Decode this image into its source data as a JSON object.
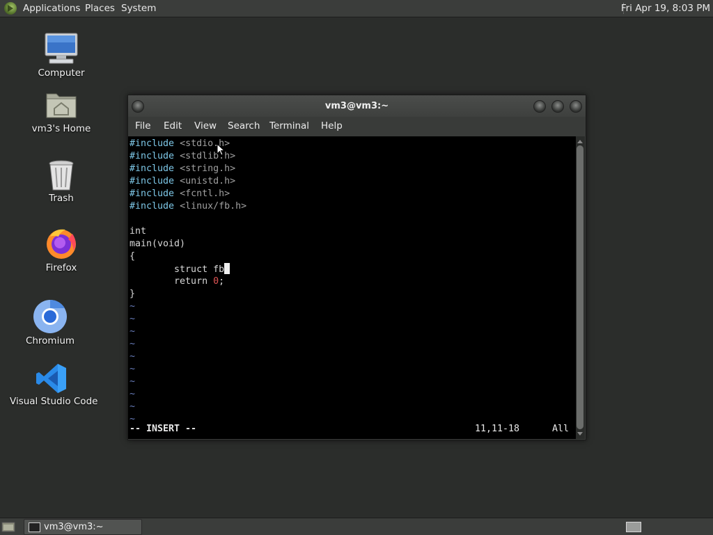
{
  "top_panel": {
    "menus": [
      "Applications",
      "Places",
      "System"
    ],
    "clock": "Fri Apr 19,  8:03 PM"
  },
  "desktop": {
    "icons": [
      {
        "label": "Computer",
        "icon": "computer-icon"
      },
      {
        "label": "vm3's Home",
        "icon": "home-folder-icon"
      },
      {
        "label": "Trash",
        "icon": "trash-icon"
      },
      {
        "label": "Firefox",
        "icon": "firefox-icon"
      },
      {
        "label": "Chromium",
        "icon": "chromium-icon"
      },
      {
        "label": "Visual Studio Code",
        "icon": "vscode-icon"
      }
    ]
  },
  "terminal": {
    "title": "vm3@vm3:~",
    "menu": [
      "File",
      "Edit",
      "View",
      "Search",
      "Terminal",
      "Help"
    ],
    "includes": [
      {
        "directive": "#include",
        "header": "<stdio.h>"
      },
      {
        "directive": "#include",
        "header": "<stdlib.h>"
      },
      {
        "directive": "#include",
        "header": "<string.h>"
      },
      {
        "directive": "#include",
        "header": "<unistd.h>"
      },
      {
        "directive": "#include",
        "header": "<fcntl.h>"
      },
      {
        "directive": "#include",
        "header": "<linux/fb.h>"
      }
    ],
    "code": {
      "type": "int",
      "func": "main",
      "params": "(void)",
      "open_brace": "{",
      "line1": "        struct fb",
      "return_kw": "        return ",
      "return_val": "0",
      "return_end": ";",
      "close_brace": "}"
    },
    "tilde": "~",
    "tilde_count": 10,
    "status": {
      "mode": "-- INSERT --",
      "position": "11,11-18",
      "scroll": "All"
    }
  },
  "taskbar": {
    "task_label": "vm3@vm3:~"
  },
  "colors": {
    "desktop_bg": "#2b2d2b",
    "panel_bg": "#3b3d3b",
    "preprocessor": "#7ec8e8",
    "header_text": "#a0a0a0",
    "number": "#e05555",
    "tilde": "#6a7fbf"
  }
}
